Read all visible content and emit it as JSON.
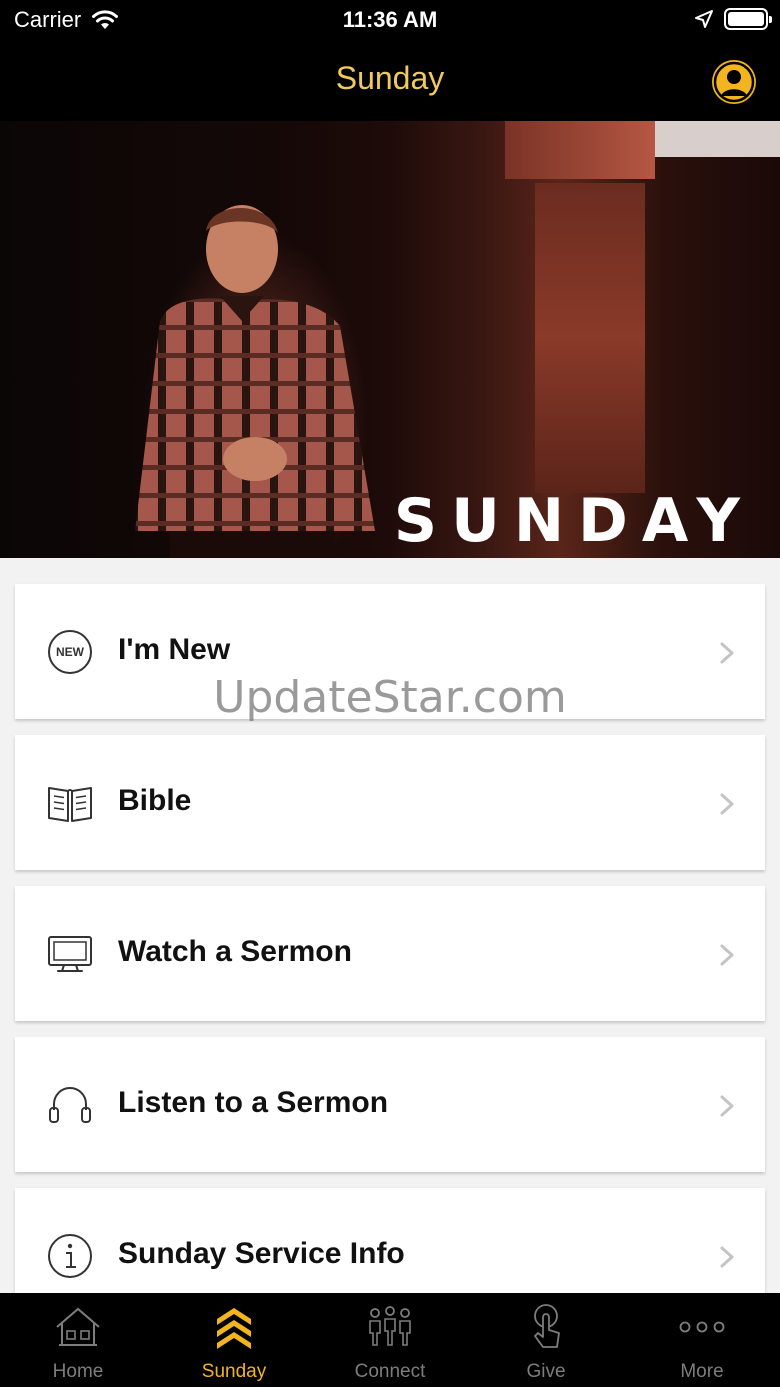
{
  "status_bar": {
    "carrier": "Carrier",
    "time": "11:36 AM"
  },
  "nav": {
    "title": "Sunday"
  },
  "hero": {
    "label": "SUNDAY"
  },
  "menu": [
    {
      "label": "I'm New",
      "icon": "new-badge-icon"
    },
    {
      "label": "Bible",
      "icon": "open-book-icon"
    },
    {
      "label": "Watch a Sermon",
      "icon": "monitor-icon"
    },
    {
      "label": "Listen to a Sermon",
      "icon": "headphones-icon"
    },
    {
      "label": "Sunday Service Info",
      "icon": "info-icon"
    }
  ],
  "new_badge_text": "NEW",
  "watermark": "UpdateStar.com",
  "tabs": [
    {
      "label": "Home",
      "icon": "house-icon",
      "active": false
    },
    {
      "label": "Sunday",
      "icon": "chevrons-up-icon",
      "active": true
    },
    {
      "label": "Connect",
      "icon": "people-icon",
      "active": false
    },
    {
      "label": "Give",
      "icon": "hand-tap-icon",
      "active": false
    },
    {
      "label": "More",
      "icon": "ellipsis-icon",
      "active": false
    }
  ],
  "colors": {
    "accent": "#f2b51f",
    "title": "#f1c95c",
    "inactive_tab": "#7d7d7d"
  }
}
